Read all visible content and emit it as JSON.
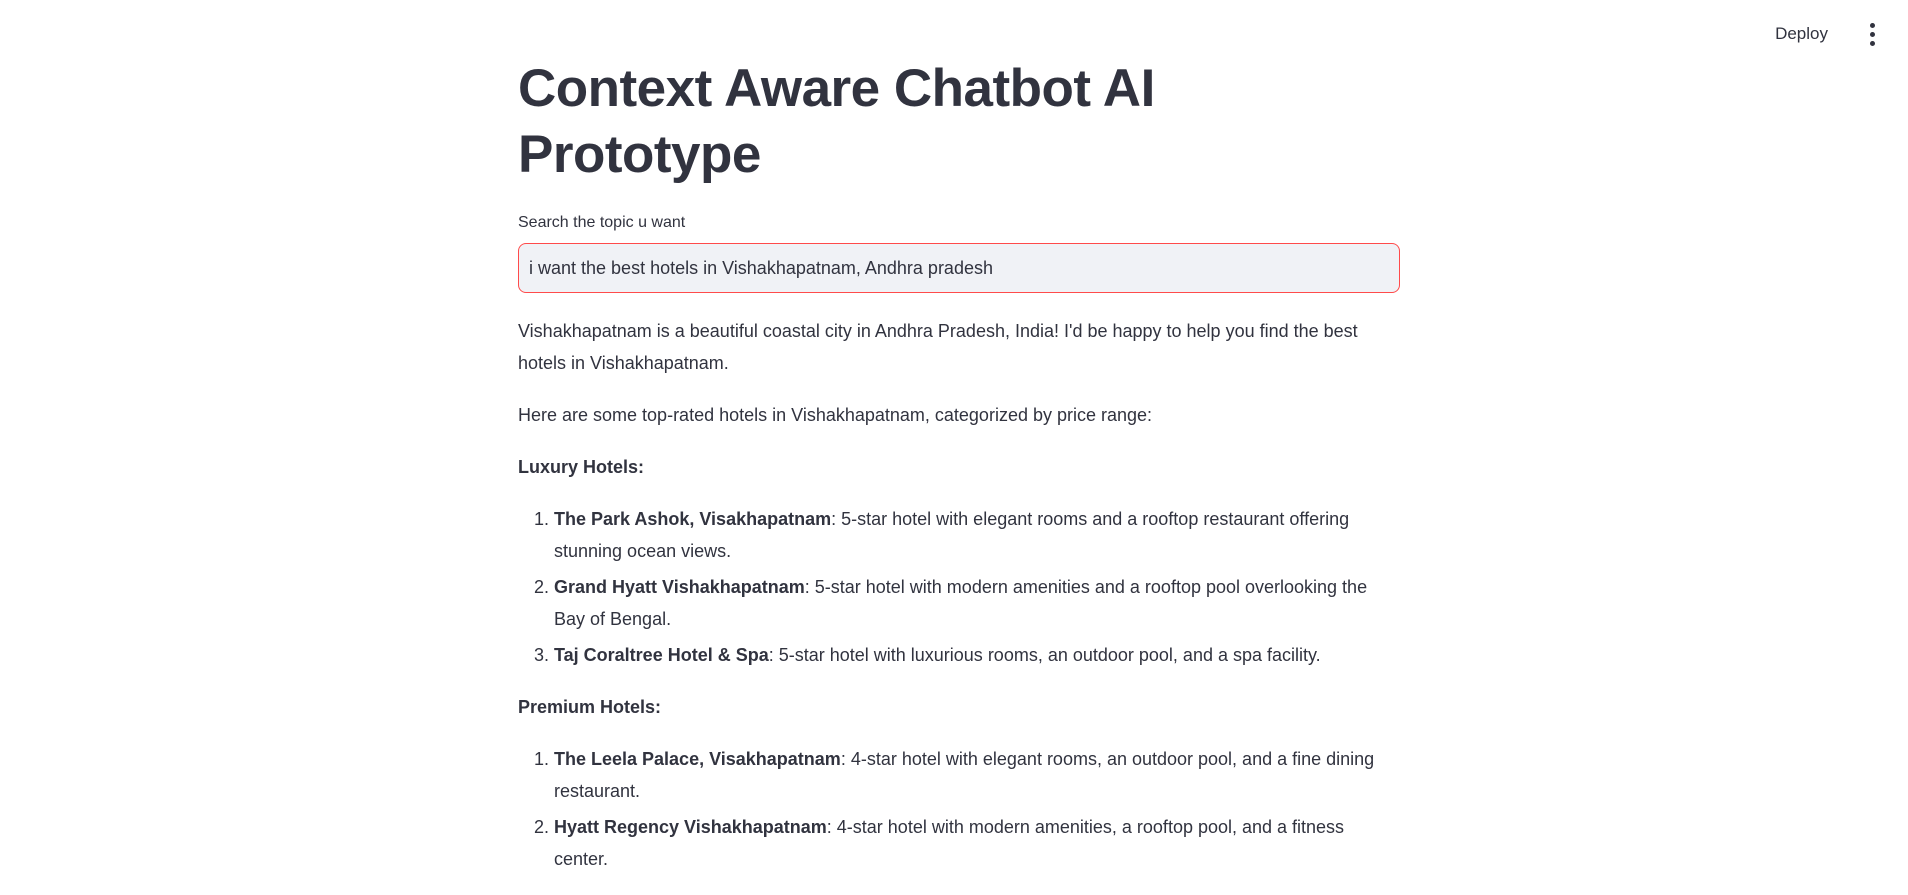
{
  "toolbar": {
    "deploy_label": "Deploy",
    "menu_icon": "vertical-ellipsis-icon"
  },
  "main": {
    "title": "Context Aware Chatbot AI Prototype",
    "search": {
      "label": "Search the topic u want",
      "value": "i want the best hotels in Vishakhapatnam, Andhra pradesh"
    },
    "response": {
      "intro": "Vishakhapatnam is a beautiful coastal city in Andhra Pradesh, India! I'd be happy to help you find the best hotels in Vishakhapatnam.",
      "subintro": "Here are some top-rated hotels in Vishakhapatnam, categorized by price range:",
      "sections": [
        {
          "heading": "Luxury Hotels:",
          "hotels": [
            {
              "name": "The Park Ashok, Visakhapatnam",
              "description": ": 5-star hotel with elegant rooms and a rooftop restaurant offering stunning ocean views."
            },
            {
              "name": "Grand Hyatt Vishakhapatnam",
              "description": ": 5-star hotel with modern amenities and a rooftop pool overlooking the Bay of Bengal."
            },
            {
              "name": "Taj Coraltree Hotel & Spa",
              "description": ": 5-star hotel with luxurious rooms, an outdoor pool, and a spa facility."
            }
          ]
        },
        {
          "heading": "Premium Hotels:",
          "hotels": [
            {
              "name": "The Leela Palace, Visakhapatnam",
              "description": ": 4-star hotel with elegant rooms, an outdoor pool, and a fine dining restaurant."
            },
            {
              "name": "Hyatt Regency Vishakhapatnam",
              "description": ": 4-star hotel with modern amenities, a rooftop pool, and a fitness center."
            }
          ]
        }
      ]
    }
  }
}
